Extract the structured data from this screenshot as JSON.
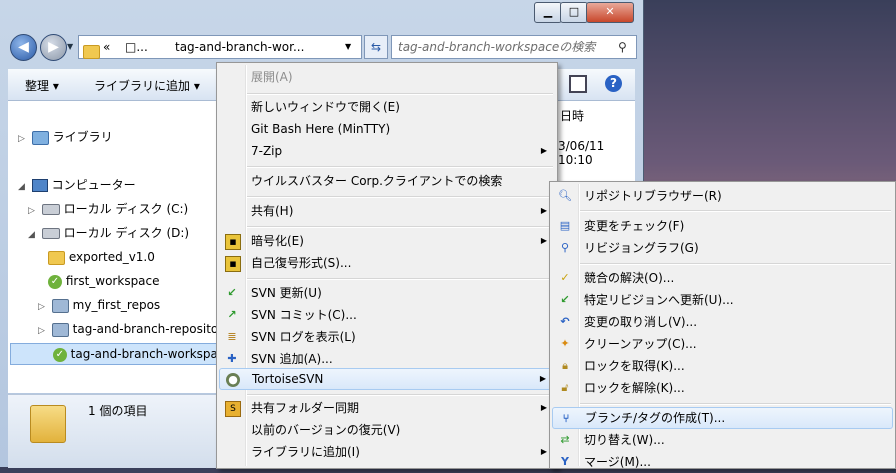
{
  "window": {
    "minimize": "▁",
    "maximize": "□",
    "close": "✕",
    "back": "◀",
    "forward": "▶",
    "address_prefix": "«",
    "address_mid": "□...",
    "address_text": "tag-and-branch-wor...",
    "search_placeholder": "tag-and-branch-workspaceの検索"
  },
  "toolbar": {
    "organize": "整理 ▾",
    "add_to_library": "ライブラリに追加 ▾"
  },
  "columns": {
    "date_header": "日時",
    "date_value": "3/06/11 10:10"
  },
  "tree": [
    {
      "label": "ライブラリ",
      "icon": "library-icon"
    },
    {
      "label": "コンピューター",
      "icon": "computer-icon"
    },
    {
      "label": "ローカル ディスク (C:)",
      "icon": "drive-icon"
    },
    {
      "label": "ローカル ディスク (D:)",
      "icon": "drive-icon"
    },
    {
      "label": "exported_v1.0",
      "icon": "folder-icon"
    },
    {
      "label": "first_workspace",
      "icon": "svn-folder-icon"
    },
    {
      "label": "my_first_repos",
      "icon": "repo-icon"
    },
    {
      "label": "tag-and-branch-repositor",
      "icon": "repo-icon"
    },
    {
      "label": "tag-and-branch-workspac",
      "icon": "svn-folder-icon"
    }
  ],
  "status": {
    "selection_count": "1 個の項目"
  },
  "context_menu": {
    "items": [
      {
        "label": "展開(A)"
      },
      {
        "label": "新しいウィンドウで開く(E)"
      },
      {
        "label": "Git Bash Here (MinTTY)"
      },
      {
        "label": "7-Zip"
      },
      {
        "label": "ウイルスバスター Corp.クライアントでの検索"
      },
      {
        "label": "共有(H)"
      },
      {
        "label": "暗号化(E)"
      },
      {
        "label": "自己復号形式(S)..."
      },
      {
        "label": "SVN 更新(U)"
      },
      {
        "label": "SVN コミット(C)..."
      },
      {
        "label": "SVN ログを表示(L)"
      },
      {
        "label": "SVN 追加(A)..."
      },
      {
        "label": "TortoiseSVN"
      },
      {
        "label": "共有フォルダー同期"
      },
      {
        "label": "以前のバージョンの復元(V)"
      },
      {
        "label": "ライブラリに追加(I)"
      }
    ],
    "submenu_arrow": "▶"
  },
  "svn_submenu": {
    "items": [
      {
        "label": "リポジトリブラウザー(R)"
      },
      {
        "label": "変更をチェック(F)"
      },
      {
        "label": "リビジョングラフ(G)"
      },
      {
        "label": "競合の解決(O)..."
      },
      {
        "label": "特定リビジョンへ更新(U)..."
      },
      {
        "label": "変更の取り消し(V)..."
      },
      {
        "label": "クリーンアップ(C)..."
      },
      {
        "label": "ロックを取得(K)..."
      },
      {
        "label": "ロックを解除(K)..."
      },
      {
        "label": "ブランチ/タグの作成(T)..."
      },
      {
        "label": "切り替え(W)..."
      },
      {
        "label": "マージ(M)..."
      }
    ]
  },
  "colors": {
    "highlight_border": "#a8cbf1",
    "menu_bg": "#f0f0f0",
    "window_frame": "#b9cbe2"
  }
}
